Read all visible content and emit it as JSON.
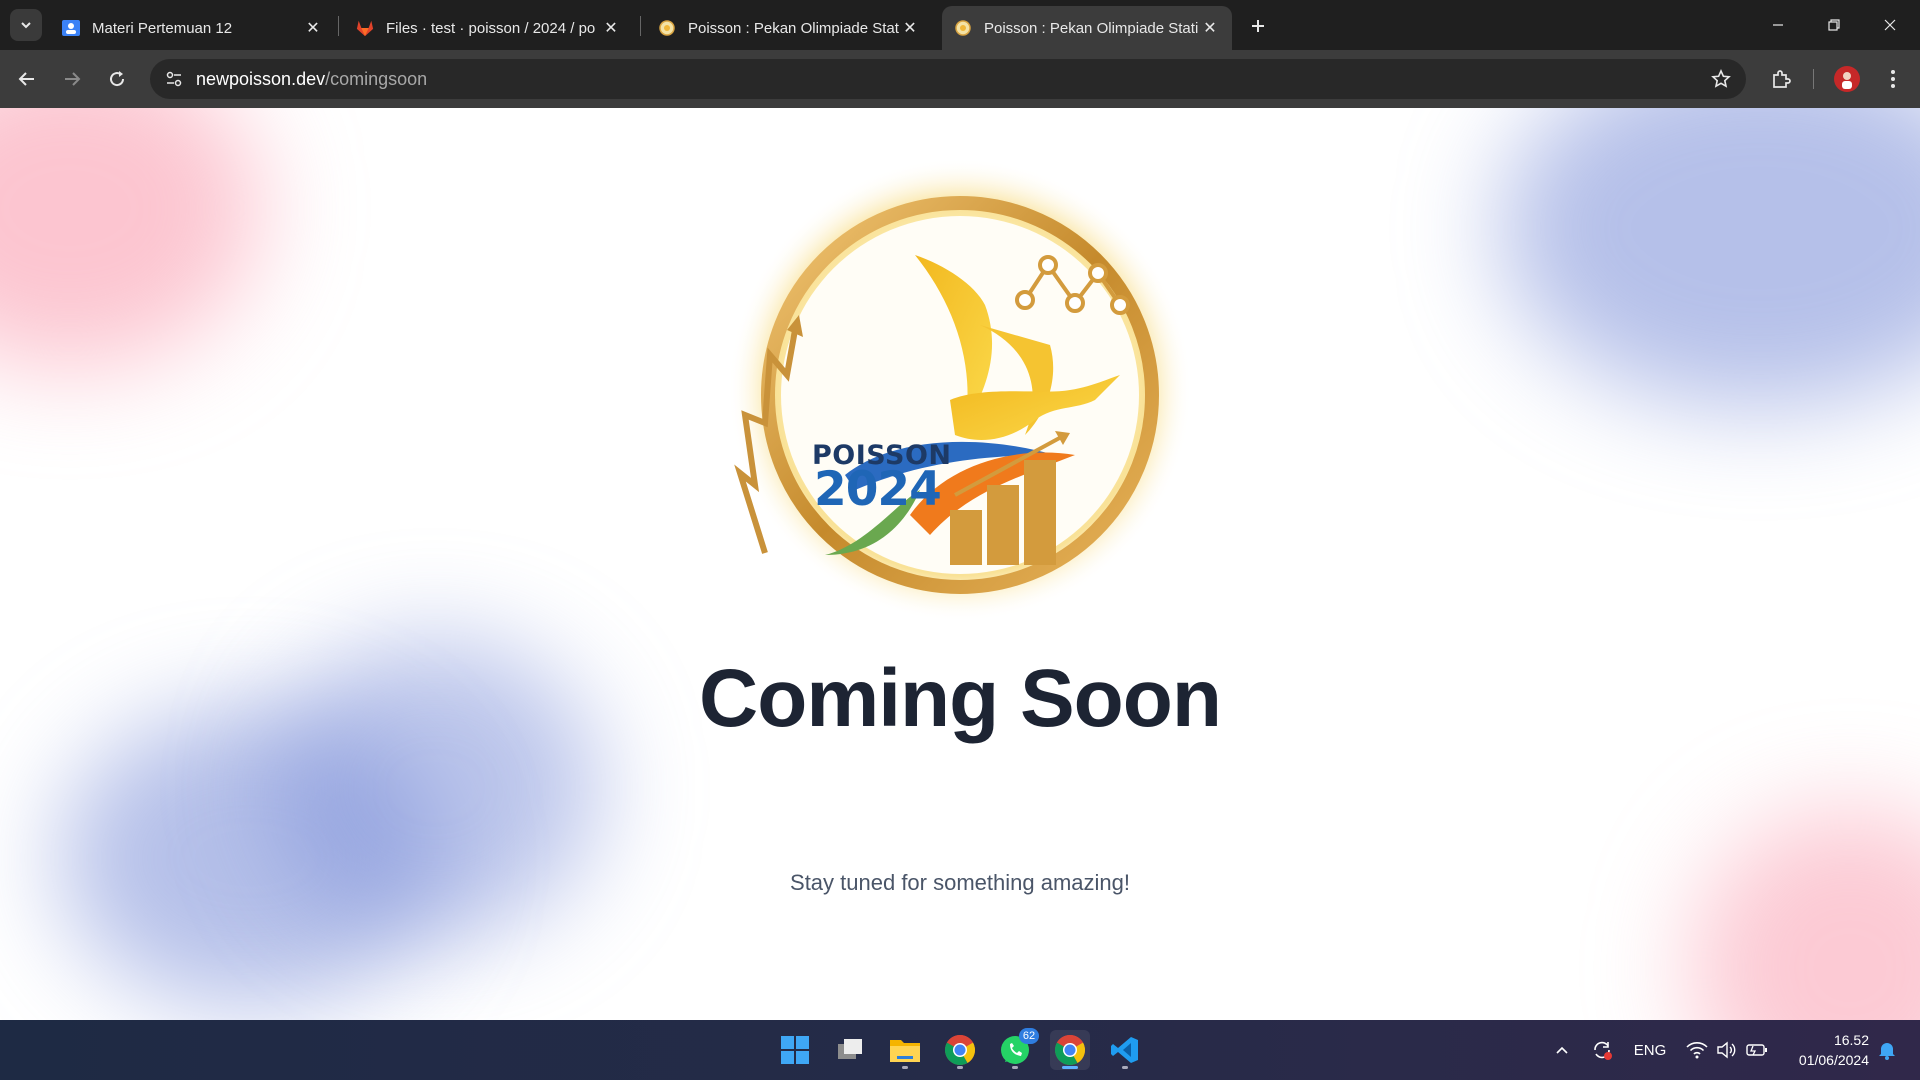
{
  "browser": {
    "tabs": [
      {
        "title": "Materi Pertemuan 12",
        "favicon": "classroom-icon",
        "active": false
      },
      {
        "title": "Files · test · poisson / 2024 / po",
        "favicon": "gitlab-icon",
        "active": false
      },
      {
        "title": "Poisson : Pekan Olimpiade Stati",
        "favicon": "poisson-favicon",
        "active": false
      },
      {
        "title": "Poisson : Pekan Olimpiade Stati",
        "favicon": "poisson-favicon",
        "active": true
      }
    ],
    "url_domain": "newpoisson.dev",
    "url_path": "/comingsoon"
  },
  "page": {
    "logo_line1": "POISSON",
    "logo_line2": "2024",
    "heading": "Coming Soon",
    "subtitle": "Stay tuned for something amazing!"
  },
  "taskbar": {
    "apps": [
      {
        "name": "start",
        "icon": "windows-icon"
      },
      {
        "name": "task-view",
        "icon": "task-view-icon"
      },
      {
        "name": "file-explorer",
        "icon": "folder-icon"
      },
      {
        "name": "chrome-profile",
        "icon": "chrome-icon"
      },
      {
        "name": "whatsapp",
        "icon": "whatsapp-icon",
        "badge": "62"
      },
      {
        "name": "chrome",
        "icon": "chrome-icon",
        "active": true
      },
      {
        "name": "vscode",
        "icon": "vscode-icon"
      }
    ],
    "language": "ENG",
    "time": "16.52",
    "date": "01/06/2024"
  },
  "colors": {
    "heading": "#1d2433",
    "subtitle": "#4a5568",
    "logo_gold": "#d9a441",
    "logo_blue": "#1f66b6"
  }
}
